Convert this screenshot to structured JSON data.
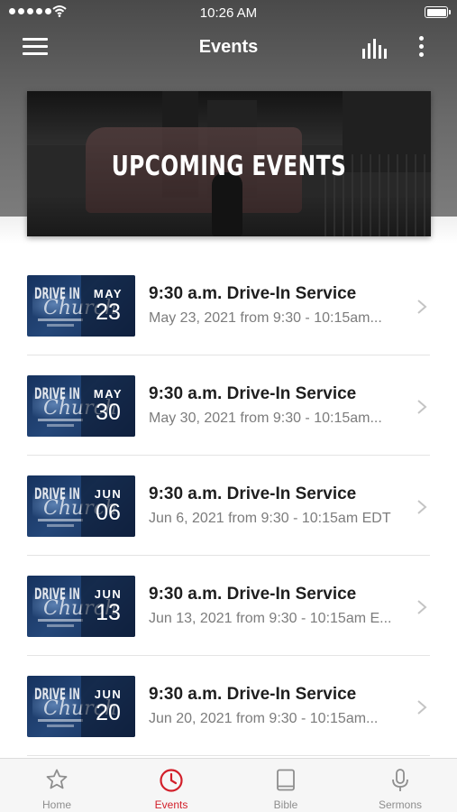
{
  "status_bar": {
    "time": "10:26 AM"
  },
  "nav": {
    "title": "Events"
  },
  "banner": {
    "title": "UPCOMING EVENTS"
  },
  "events": [
    {
      "title": "9:30 a.m. Drive-In Service",
      "date_text": "May 23, 2021 from 9:30 - 10:15am...",
      "month": "MAY",
      "day": "23",
      "thumb_text": "DRIVE IN"
    },
    {
      "title": "9:30 a.m. Drive-In Service",
      "date_text": "May 30, 2021 from 9:30 - 10:15am...",
      "month": "MAY",
      "day": "30",
      "thumb_text": "DRIVE IN"
    },
    {
      "title": "9:30 a.m. Drive-In Service",
      "date_text": "Jun 6, 2021 from 9:30 - 10:15am EDT",
      "month": "JUN",
      "day": "06",
      "thumb_text": "DRIVE IN"
    },
    {
      "title": "9:30 a.m. Drive-In Service",
      "date_text": "Jun 13, 2021 from 9:30 - 10:15am E...",
      "month": "JUN",
      "day": "13",
      "thumb_text": "DRIVE IN"
    },
    {
      "title": "9:30 a.m. Drive-In Service",
      "date_text": "Jun 20, 2021 from 9:30 - 10:15am...",
      "month": "JUN",
      "day": "20",
      "thumb_text": "DRIVE IN"
    }
  ],
  "tabs": [
    {
      "label": "Home",
      "icon": "star-icon",
      "active": false
    },
    {
      "label": "Events",
      "icon": "clock-icon",
      "active": true
    },
    {
      "label": "Bible",
      "icon": "book-icon",
      "active": false
    },
    {
      "label": "Sermons",
      "icon": "microphone-icon",
      "active": false
    }
  ],
  "colors": {
    "accent": "#d21f2a",
    "inactive_tab": "#8e8e8e",
    "header_gray": "#5a5a5a",
    "thumb_blue": "#1f3d6e"
  }
}
